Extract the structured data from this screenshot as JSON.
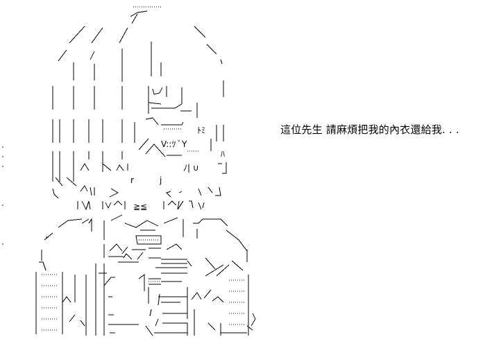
{
  "caption": {
    "text": "這位先生  請麻煩把我的內衣還給我. . ."
  },
  "ascii_art": {
    "description_icon": "ascii-art-figure-icon"
  }
}
